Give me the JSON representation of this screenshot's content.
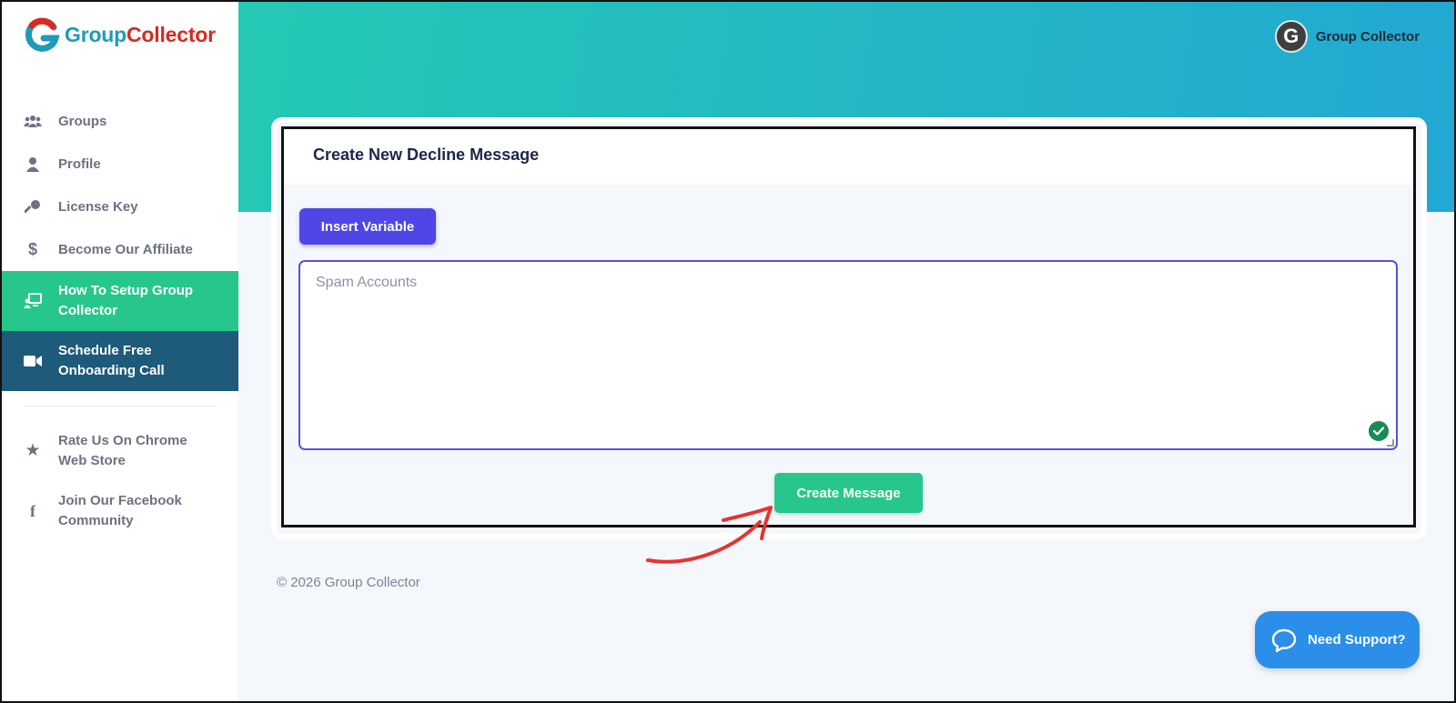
{
  "brand": {
    "name_part1": "Group",
    "name_part2": "Collector",
    "logo_icon": "group-collector-logo",
    "colors": {
      "teal": "#1e9bb8",
      "red": "#d72a22"
    }
  },
  "sidebar": {
    "items": [
      {
        "label": "Groups",
        "icon": "users-icon"
      },
      {
        "label": "Profile",
        "icon": "user-icon"
      },
      {
        "label": "License Key",
        "icon": "key-icon"
      },
      {
        "label": "Become Our Affiliate",
        "icon": "dollar-icon"
      },
      {
        "label": "How To Setup Group Collector",
        "icon": "presentation-icon",
        "state": "active",
        "color": "#27c68d"
      },
      {
        "label": "Schedule Free Onboarding Call",
        "icon": "video-icon",
        "color": "#1e5a7a"
      },
      {
        "label": "Rate Us On Chrome Web Store",
        "icon": "star-icon"
      },
      {
        "label": "Join Our Facebook Community",
        "icon": "facebook-icon"
      }
    ]
  },
  "header": {
    "user": {
      "avatar_letter": "G",
      "name": "Group Collector"
    },
    "gradient": [
      "#24c9b4",
      "#22a8d4"
    ]
  },
  "card": {
    "title": "Create New Decline Message",
    "insert_variable_label": "Insert Variable",
    "message_placeholder": "Spam Accounts",
    "message_value": "",
    "create_button_label": "Create Message"
  },
  "footer": {
    "text": "© 2026 Group Collector"
  },
  "support": {
    "label": "Need Support?",
    "icon": "chat-bubble-icon"
  }
}
